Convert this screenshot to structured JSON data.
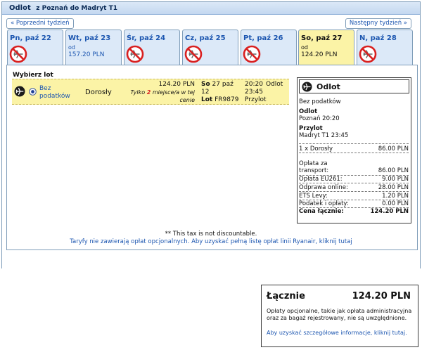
{
  "header": {
    "title": "Odlot",
    "route": "z Poznań do Madryt T1"
  },
  "nav": {
    "prev_week": "« Poprzedni tydzień",
    "next_week": "Następny tydzień »"
  },
  "days": [
    {
      "label": "Pn, paź 22",
      "sub": "",
      "price": "",
      "available": false
    },
    {
      "label": "Wt, paź 23",
      "sub": "od",
      "price": "157.20 PLN",
      "available": true
    },
    {
      "label": "Śr, paź 24",
      "sub": "",
      "price": "",
      "available": false
    },
    {
      "label": "Cz, paź 25",
      "sub": "",
      "price": "",
      "available": false
    },
    {
      "label": "Pt, paź 26",
      "sub": "",
      "price": "",
      "available": false
    },
    {
      "label": "So, paź 27",
      "sub": "od",
      "price": "124.20 PLN",
      "available": true,
      "selected": true
    },
    {
      "label": "N, paź 28",
      "sub": "",
      "price": "",
      "available": false
    }
  ],
  "flight_list": {
    "heading": "Wybierz lot",
    "fare_label_1": "Bez",
    "fare_label_2": "podatków",
    "passenger": "Dorosły",
    "price": "124.20 PLN",
    "seats_prefix": "Tylko",
    "seats_count": "2",
    "seats_suffix_1": "miejsce/a w tej",
    "seats_suffix_2": "cenie",
    "date_day": "So",
    "date_rest": "27 paź",
    "date_day_num": "12",
    "lot_label": "Lot",
    "flight_no": "FR9879",
    "dep_time": "20:20",
    "dep_label": "Odlot",
    "arr_time": "23:45",
    "arr_label": "Przylot"
  },
  "summary": {
    "title": "Odlot",
    "fare_type": "Bez podatków",
    "depart_label": "Odlot",
    "depart_value": "Poznań 20:20",
    "arrive_label": "Przylot",
    "arrive_value": "Madryt T1 23:45",
    "pax_label": "1 x Dorosły",
    "pax_price": "86.00 PLN",
    "fees": [
      {
        "label": "Opłata za",
        "label2": "transport:",
        "value": "86.00 PLN"
      },
      {
        "label": "Opłata EU261:",
        "value": "9.00 PLN"
      },
      {
        "label": "Odprawa online:",
        "value": "28.00 PLN"
      },
      {
        "label": "ETS Levy:",
        "value": "1.20 PLN"
      },
      {
        "label": "Podatek i opłaty:",
        "value": "0.00 PLN"
      }
    ],
    "total_label": "Cena łącznie:",
    "total_value": "124.20 PLN"
  },
  "notes": {
    "discount": "** This tax is not discountable.",
    "optional_fees": "Taryfy nie zawierają opłat opcjonalnych. Aby uzyskać pełną listę opłat linii Ryanair, kliknij tutaj"
  },
  "total_box": {
    "label": "Łącznie",
    "amount": "124.20 PLN",
    "text": "Opłaty opcjonalne, takie jak opłata administracyjna oraz za bagaż rejestrowany, nie są uwzględnione.",
    "link": "Aby uzyskać szczegółowe informacje, kliknij tutaj."
  },
  "colors": {
    "accent": "#1c56b0",
    "selected_bg": "#fbf3a6",
    "tab_bg": "#dce9f8",
    "no_flight": "#d92020"
  },
  "icons": {
    "no_flight": "no-flight-icon",
    "plane": "plane-icon"
  }
}
